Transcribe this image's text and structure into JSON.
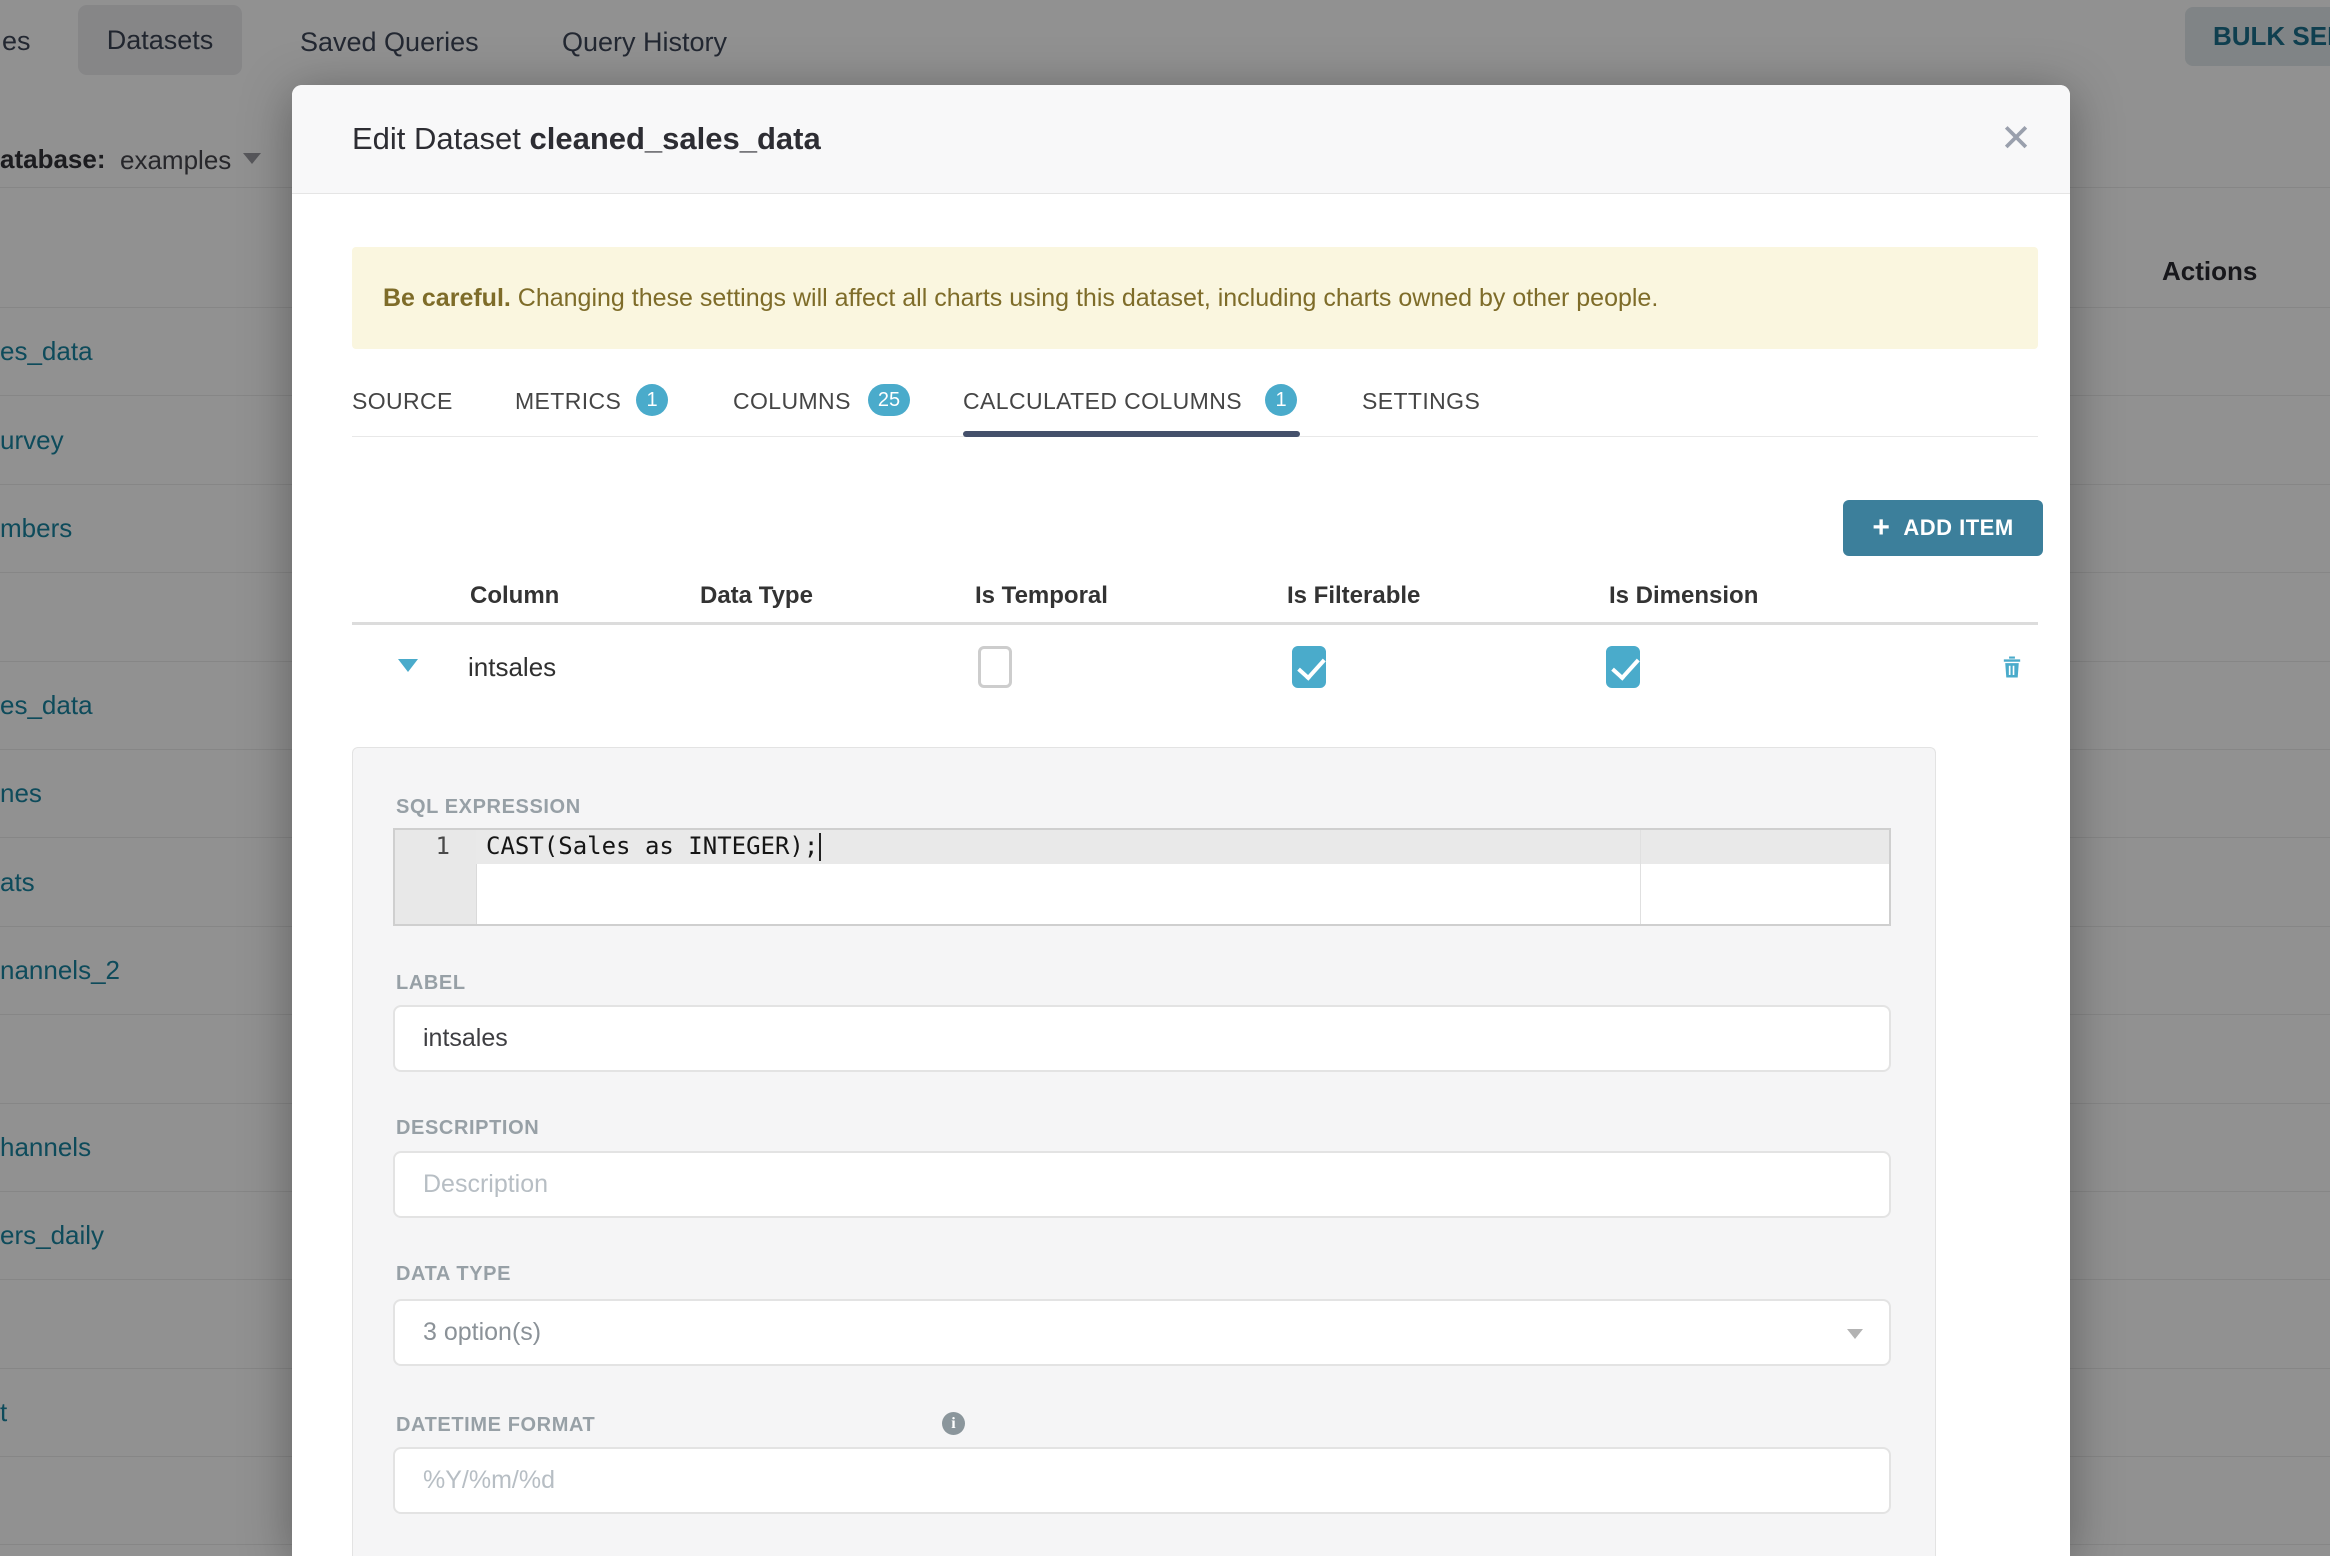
{
  "nav": {
    "clipped_tab": "es",
    "datasets": "Datasets",
    "saved_queries": "Saved Queries",
    "query_history": "Query History",
    "bulk_select": "BULK SELECT"
  },
  "filter": {
    "database_label": "atabase:",
    "database_value": "examples"
  },
  "list": {
    "actions_header": "Actions",
    "rows": [
      "es_data",
      "urvey",
      "mbers",
      "",
      "es_data",
      "nes",
      "ats",
      "nannels_2",
      "",
      "hannels",
      "ers_daily",
      "",
      "t",
      ""
    ]
  },
  "modal": {
    "title_prefix": "Edit Dataset ",
    "title_name": "cleaned_sales_data",
    "close_icon": "✕",
    "warning_bold": "Be careful.",
    "warning_text": " Changing these settings will affect all charts using this dataset, including charts owned by other people.",
    "tabs": [
      {
        "label": "SOURCE"
      },
      {
        "label": "METRICS",
        "badge": "1"
      },
      {
        "label": "COLUMNS",
        "badge": "25"
      },
      {
        "label": "CALCULATED COLUMNS",
        "badge": "1",
        "active": true
      },
      {
        "label": "SETTINGS"
      }
    ],
    "add_item_icon": "+",
    "add_item_label": "ADD ITEM",
    "table": {
      "headers": [
        "Column",
        "Data Type",
        "Is Temporal",
        "Is Filterable",
        "Is Dimension"
      ],
      "row": {
        "name": "intsales",
        "is_temporal": false,
        "is_filterable": true,
        "is_dimension": true
      }
    },
    "panel": {
      "sql_label": "SQL EXPRESSION",
      "line_number": "1",
      "sql_code": "CAST(Sales as INTEGER);",
      "label_label": "LABEL",
      "label_value": "intsales",
      "description_label": "DESCRIPTION",
      "description_placeholder": "Description",
      "datatype_label": "DATA TYPE",
      "datatype_value": "3 option(s)",
      "datetime_label": "DATETIME FORMAT",
      "datetime_info": "i",
      "datetime_placeholder": "%Y/%m/%d"
    }
  },
  "colors": {
    "accent_teal": "#4aabcb",
    "link_teal": "#1985a0",
    "button_teal": "#3c7f9b",
    "tab_underline": "#44506b",
    "warning_bg": "#faf6df",
    "warning_text": "#7e6c29"
  }
}
